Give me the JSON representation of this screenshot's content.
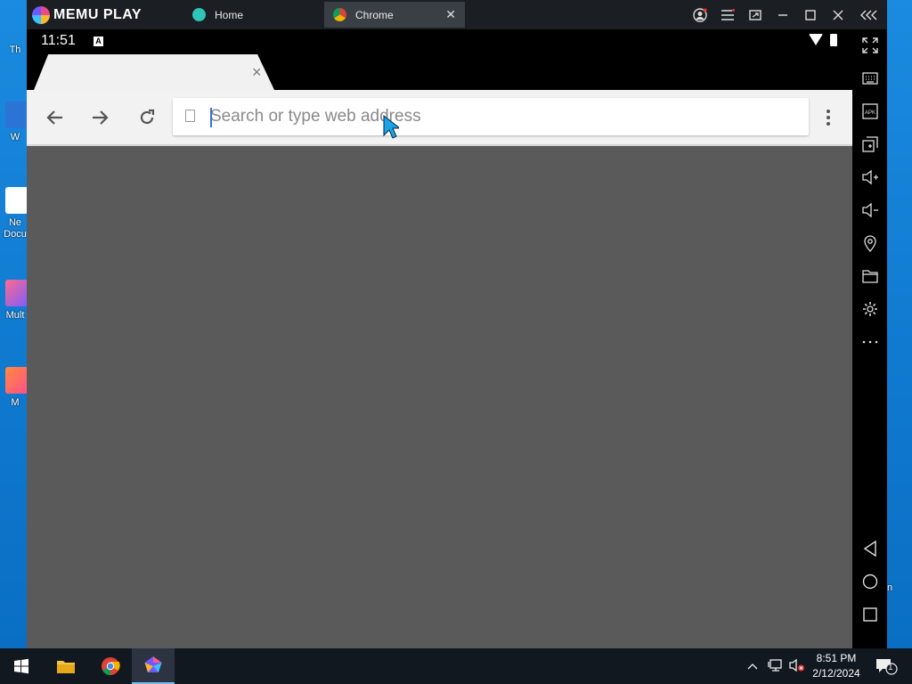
{
  "desktop": {
    "icons": [
      {
        "label": "Th"
      },
      {
        "label": "W"
      },
      {
        "label": "Ne\nDocu"
      },
      {
        "label": "Mult"
      },
      {
        "label": "M"
      }
    ],
    "right_label": "n"
  },
  "memu": {
    "brand": "MEMU PLAY",
    "tabs": [
      {
        "label": "Home"
      },
      {
        "label": "Chrome"
      }
    ]
  },
  "android": {
    "status_time": "11:51",
    "status_badge": "A"
  },
  "chrome": {
    "tab_close": "×",
    "omnibox_placeholder": "Search or type web address",
    "omnibox_value": ""
  },
  "taskbar": {
    "time": "8:51 PM",
    "date": "2/12/2024",
    "notification_count": "1"
  },
  "colors": {
    "accent": "#3a6fd8",
    "page_background": "#5a5a5a",
    "toolbar_background": "#f2f2f2",
    "titlebar": "#1b1f24",
    "desktop": "#0f78cf"
  }
}
